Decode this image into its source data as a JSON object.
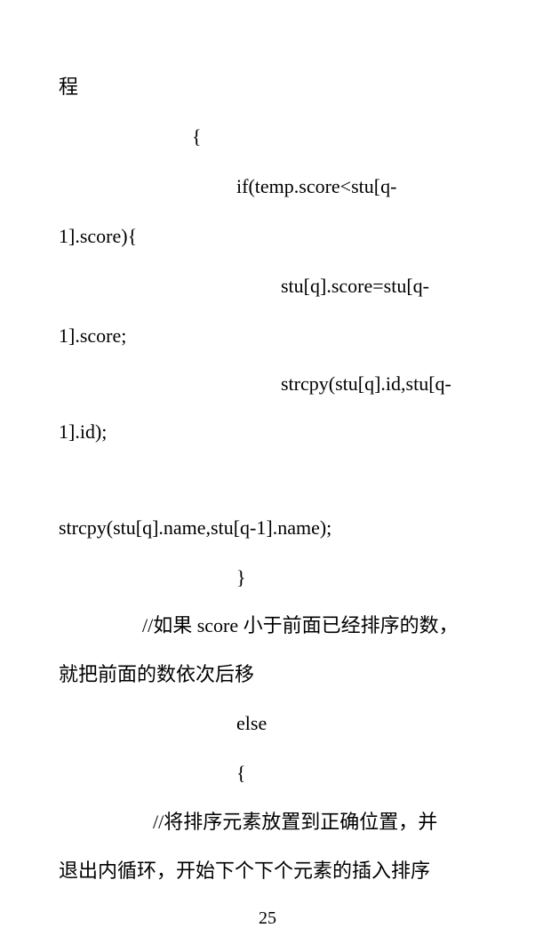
{
  "document": {
    "lines": [
      "程",
      "{",
      "if(temp.score<stu[q-",
      "1].score){",
      "stu[q].score=stu[q-",
      "1].score;",
      "strcpy(stu[q].id,stu[q-",
      "1].id);",
      "strcpy(stu[q].name,stu[q-1].name);",
      "}",
      "//如果 score 小于前面已经排序的数，",
      "就把前面的数依次后移",
      "else",
      "{",
      "//将排序元素放置到正确位置，并",
      "退出内循环，开始下个下个元素的插入排序"
    ],
    "page_number": "25"
  }
}
